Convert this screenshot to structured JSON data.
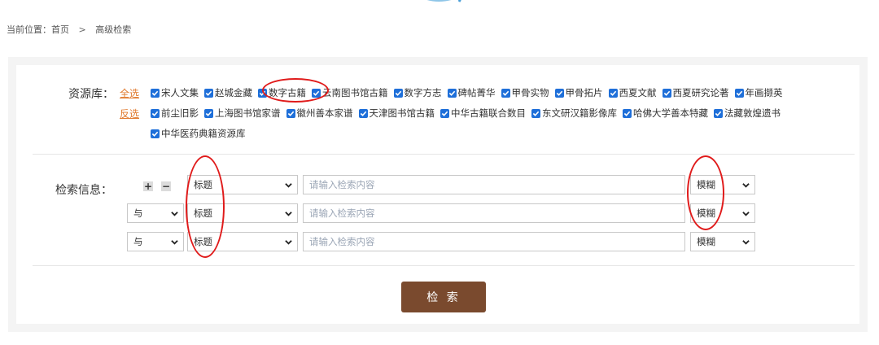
{
  "breadcrumb": {
    "prefix": "当前位置：首页",
    "separator": ">",
    "current": "高级检索"
  },
  "resources": {
    "label": "资源库：",
    "select_all": "全选",
    "invert_select": "反选",
    "row1": [
      "宋人文集",
      "赵城金藏",
      "数字古籍",
      "云南图书馆古籍",
      "数字方志",
      "碑帖菁华",
      "甲骨实物",
      "甲骨拓片",
      "西夏文献",
      "西夏研究论著",
      "年画撷英"
    ],
    "row2": [
      "前尘旧影",
      "上海图书馆家谱",
      "徽州善本家谱",
      "天津图书馆古籍",
      "中华古籍联合数目",
      "东文研汉籍影像库",
      "哈佛大学善本特藏",
      "法藏敦煌遗书"
    ],
    "row3": [
      "中华医药典籍资源库"
    ],
    "all_checked": true
  },
  "search": {
    "label": "检索信息：",
    "add_symbol": "+",
    "remove_symbol": "−",
    "rows": [
      {
        "logic": "",
        "field": "标题",
        "placeholder": "请输入检索内容",
        "mode": "模糊"
      },
      {
        "logic": "与",
        "field": "标题",
        "placeholder": "请输入检索内容",
        "mode": "模糊"
      },
      {
        "logic": "与",
        "field": "标题",
        "placeholder": "请输入检索内容",
        "mode": "模糊"
      }
    ],
    "button": "检 索"
  },
  "colors": {
    "accent_link": "#e07a2f",
    "checkbox": "#1e6fd9",
    "button": "#7a4a2e",
    "annotation": "#e01b1b"
  }
}
